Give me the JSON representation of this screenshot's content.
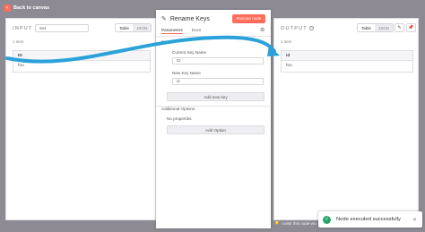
{
  "topbar": {
    "back_label": "Back to canvas"
  },
  "input_panel": {
    "title": "INPUT",
    "select_value": "Set",
    "view_table": "Table",
    "view_json": "JSON",
    "item_count": "1 item",
    "column": "ID",
    "value": "foo"
  },
  "output_panel": {
    "title": "OUTPUT",
    "info_icon": "info-icon",
    "view_table": "Table",
    "view_json": "JSON",
    "item_count": "1 item",
    "column": "id",
    "value": "foo"
  },
  "node": {
    "title": "Rename Keys",
    "execute_label": "Execute node",
    "tabs": [
      "Parameters",
      "Docs"
    ],
    "keys_label": "Keys",
    "current_key_label": "Current Key Name",
    "current_key_value": "ID",
    "new_key_label": "New Key Name",
    "new_key_value": "id",
    "add_key_label": "Add new key",
    "additional_options_label": "Additional Options",
    "no_properties": "No properties",
    "add_option_label": "Add Option"
  },
  "footer": {
    "wish_text": "I wish this node wo"
  },
  "toast": {
    "message": "Node executed successfully"
  },
  "colors": {
    "accent": "#ff6d5a",
    "arrow": "#2aa2d9",
    "success": "#29a36a",
    "backdrop": "#8d8a93"
  }
}
